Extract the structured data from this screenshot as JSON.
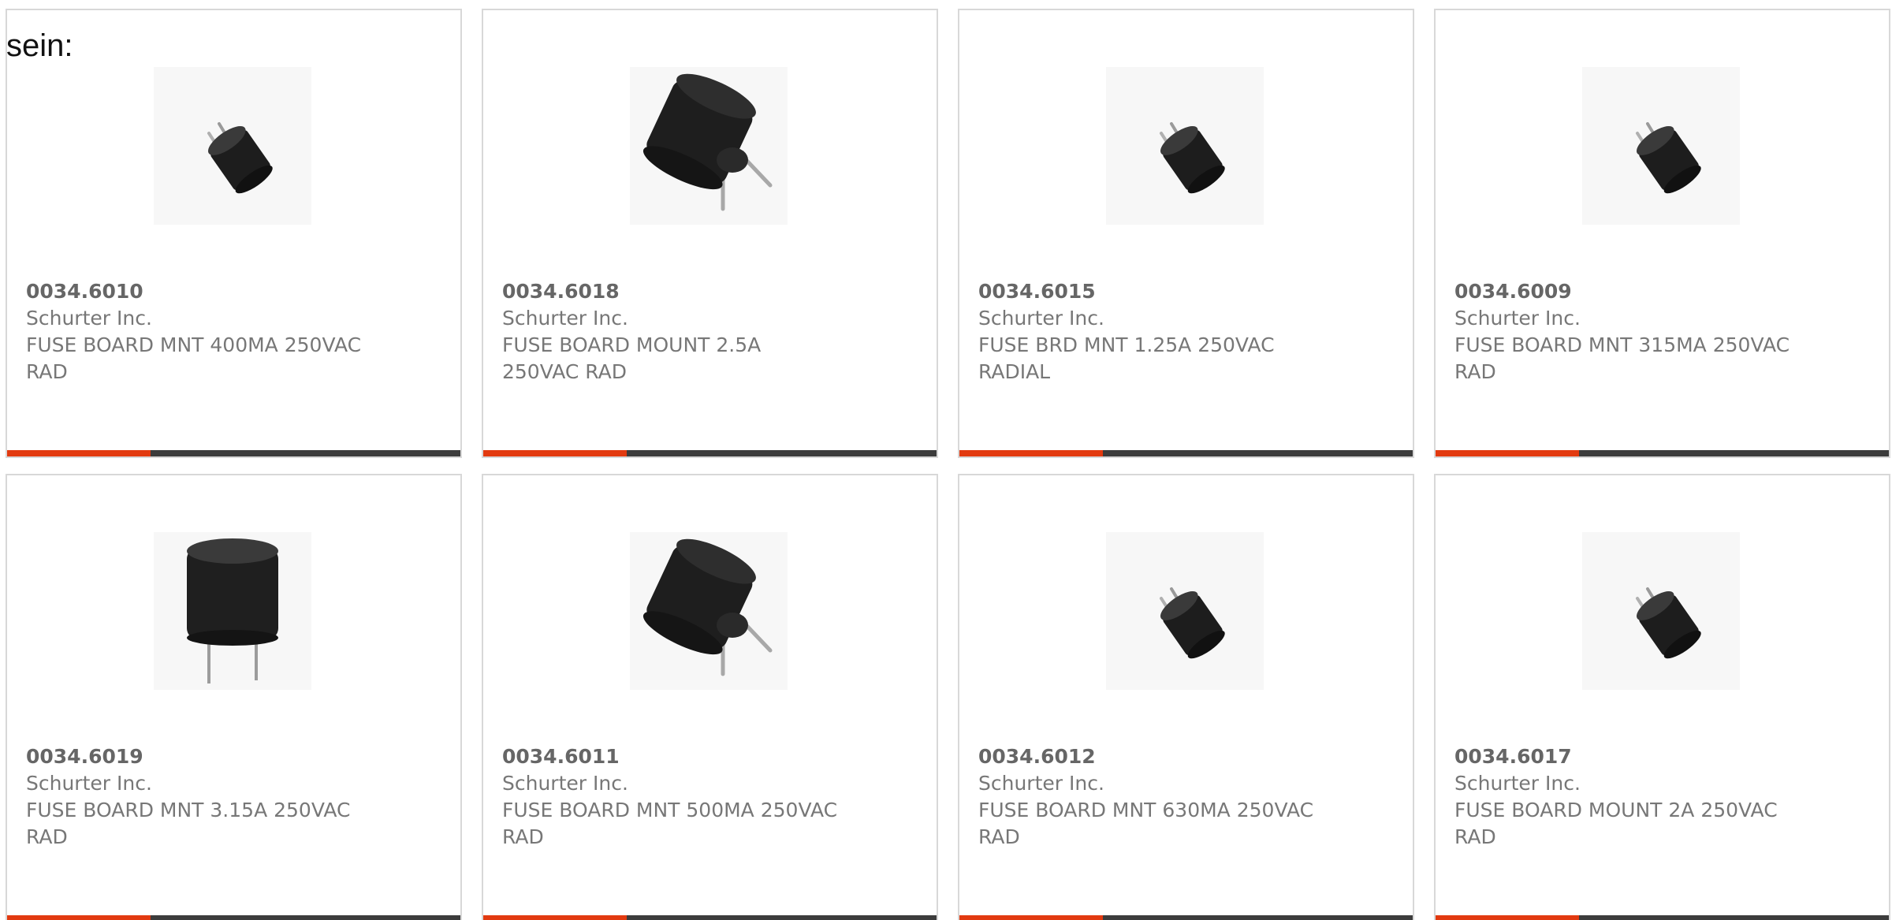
{
  "heading": "sein:",
  "colors": {
    "card_border": "#d8d8d8",
    "accent_bar": "#e23a10",
    "bar_dark": "#3c3c3c",
    "text": "#777777"
  },
  "products": [
    {
      "part": "0034.6010",
      "manufacturer": "Schurter Inc.",
      "description": "FUSE BOARD MNT 400MA 250VAC RAD",
      "image": "fuse-small-tilted-icon"
    },
    {
      "part": "0034.6018",
      "manufacturer": "Schurter Inc.",
      "description": "FUSE BOARD MOUNT 2.5A 250VAC RAD",
      "image": "fuse-large-tilted-icon"
    },
    {
      "part": "0034.6015",
      "manufacturer": "Schurter Inc.",
      "description": "FUSE BRD MNT 1.25A 250VAC RADIAL",
      "image": "fuse-small-tilted-icon"
    },
    {
      "part": "0034.6009",
      "manufacturer": "Schurter Inc.",
      "description": "FUSE BOARD MNT 315MA 250VAC RAD",
      "image": "fuse-small-tilted-icon"
    },
    {
      "part": "0034.6019",
      "manufacturer": "Schurter Inc.",
      "description": "FUSE BOARD MNT 3.15A 250VAC RAD",
      "image": "fuse-upright-icon"
    },
    {
      "part": "0034.6011",
      "manufacturer": "Schurter Inc.",
      "description": "FUSE BOARD MNT 500MA 250VAC RAD",
      "image": "fuse-large-tilted-icon"
    },
    {
      "part": "0034.6012",
      "manufacturer": "Schurter Inc.",
      "description": "FUSE BOARD MNT 630MA 250VAC RAD",
      "image": "fuse-small-tilted-icon"
    },
    {
      "part": "0034.6017",
      "manufacturer": "Schurter Inc.",
      "description": "FUSE BOARD MOUNT 2A 250VAC RAD",
      "image": "fuse-small-tilted-icon"
    }
  ]
}
